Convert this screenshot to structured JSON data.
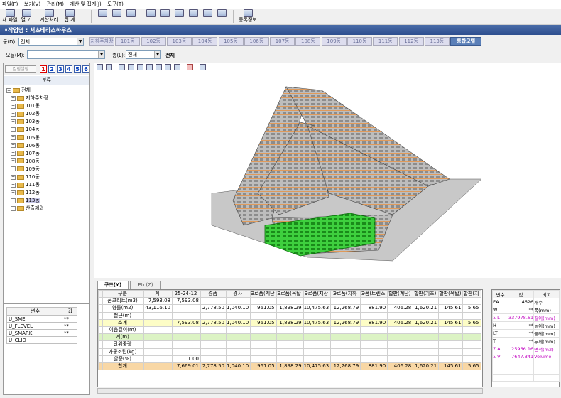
{
  "menu": [
    "파일(F)",
    "보기(V)",
    "관리(M)",
    "계산 및 집계(J)",
    "도구(T)"
  ],
  "toolbar": {
    "new_file": "새 파일",
    "open": "열 기",
    "calc": "계산처리",
    "aggregate": "집 계",
    "register_info": "등록정보"
  },
  "project": {
    "label": "•작업명 : 서초테라스하우스"
  },
  "dong": {
    "label": "동(D):",
    "value": "전체"
  },
  "dong_tabs": [
    "지하주차장",
    "101동",
    "102동",
    "103동",
    "104동",
    "105동",
    "106동",
    "107동",
    "108동",
    "109동",
    "110동",
    "111동",
    "112동",
    "113동",
    "통합모델"
  ],
  "model": {
    "label": "모듈(M):",
    "value": ""
  },
  "floor": {
    "label": "층(L):",
    "value": "전체",
    "extra": "전체"
  },
  "left_panel": {
    "button": "칼럼설정",
    "nums": [
      "1",
      "2",
      "3",
      "4",
      "5",
      "6"
    ],
    "header": "분류",
    "root": "전체",
    "items": [
      "지하주차장",
      "101동",
      "102동",
      "103동",
      "104동",
      "105동",
      "106동",
      "107동",
      "108동",
      "109동",
      "110동",
      "111동",
      "112동",
      "113동",
      "산출제외"
    ],
    "selected": "113동"
  },
  "var_grid": {
    "headers": [
      "변수",
      "값"
    ],
    "rows": [
      {
        "name": "U_SME",
        "value": "**"
      },
      {
        "name": "U_FLEVEL",
        "value": "**"
      },
      {
        "name": "U_SMARK",
        "value": "**"
      },
      {
        "name": "U_CLID",
        "value": ""
      }
    ]
  },
  "bottom_tabs": [
    "구조(Y)",
    "Etc(Z)"
  ],
  "table": {
    "headers": [
      "구분",
      "계",
      "25-24-12",
      "경품",
      "경사",
      "Э로폼(계단",
      "Э로폼(옥탑",
      "Э로폼(지상",
      "Э로폼(지하",
      "Э폼(트렌스",
      "합판(계단)",
      "합판(기초)",
      "합판(옥탑)",
      "합판(지"
    ],
    "rows": [
      {
        "cls": "",
        "cells": [
          "콘크리트(m3)",
          "7,593.08",
          "7,593.08",
          "",
          "",
          "",
          "",
          "",
          "",
          "",
          "",
          "",
          "",
          ""
        ]
      },
      {
        "cls": "",
        "cells": [
          "형틀(m2)",
          "43,116.10",
          "",
          "2,778.50",
          "1,040.10",
          "961.05",
          "1,898.29",
          "10,475.63",
          "12,268.79",
          "881.90",
          "406.28",
          "1,620.21",
          "145.61",
          "5,65"
        ]
      },
      {
        "cls": "",
        "cells": [
          "철근(m)",
          "",
          "",
          "",
          "",
          "",
          "",
          "",
          "",
          "",
          "",
          "",
          "",
          ""
        ]
      },
      {
        "cls": "y",
        "cells": [
          "소계",
          "",
          "7,593.08",
          "2,778.50",
          "1,040.10",
          "961.05",
          "1,898.29",
          "10,475.63",
          "12,268.79",
          "881.90",
          "406.28",
          "1,620.21",
          "145.61",
          "5,65"
        ]
      },
      {
        "cls": "",
        "cells": [
          "이음길이(m)",
          "",
          "",
          "",
          "",
          "",
          "",
          "",
          "",
          "",
          "",
          "",
          "",
          ""
        ]
      },
      {
        "cls": "g",
        "cells": [
          "계(m)",
          "",
          "",
          "",
          "",
          "",
          "",
          "",
          "",
          "",
          "",
          "",
          "",
          ""
        ]
      },
      {
        "cls": "",
        "cells": [
          "단위중량",
          "",
          "",
          "",
          "",
          "",
          "",
          "",
          "",
          "",
          "",
          "",
          "",
          ""
        ]
      },
      {
        "cls": "",
        "cells": [
          "가공조립(kg)",
          "",
          "",
          "",
          "",
          "",
          "",
          "",
          "",
          "",
          "",
          "",
          "",
          ""
        ]
      },
      {
        "cls": "",
        "cells": [
          "할증(%)",
          "",
          "1.00",
          "",
          "",
          "",
          "",
          "",
          "",
          "",
          "",
          "",
          "",
          ""
        ]
      },
      {
        "cls": "o",
        "cells": [
          "합계",
          "",
          "7,669.01",
          "2,778.50",
          "1,040.10",
          "961.05",
          "1,898.29",
          "10,475.63",
          "12,268.79",
          "881.90",
          "406.28",
          "1,620.21",
          "145.61",
          "5,65"
        ]
      }
    ]
  },
  "right_table": {
    "headers": [
      "변수",
      "값",
      "비고"
    ],
    "rows": [
      {
        "name": "EA",
        "value": "4626",
        "note": "개수",
        "mag": false
      },
      {
        "name": "W",
        "value": "**",
        "note": "폭(mm)",
        "mag": false
      },
      {
        "name": "Σ L",
        "value": "337978.61",
        "note": "길이(mm)",
        "mag": true
      },
      {
        "name": "H",
        "value": "**",
        "note": "높이(mm)",
        "mag": false
      },
      {
        "name": "LT",
        "value": "**",
        "note": "둘레(mm)",
        "mag": false
      },
      {
        "name": "T",
        "value": "**",
        "note": "두께(mm)",
        "mag": false
      },
      {
        "name": "Σ A",
        "value": "25966.16",
        "note": "면적(m2)",
        "mag": true
      },
      {
        "name": "Σ V",
        "value": "7647.341",
        "note": "Volume",
        "mag": true
      },
      {
        "name": "",
        "value": "",
        "note": "",
        "mag": false
      },
      {
        "name": "",
        "value": "",
        "note": "",
        "mag": false
      },
      {
        "name": "",
        "value": "",
        "note": "",
        "mag": false
      }
    ]
  }
}
